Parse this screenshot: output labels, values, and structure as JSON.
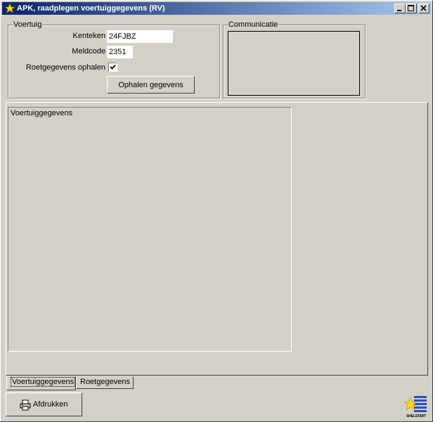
{
  "window": {
    "title": "APK, raadplegen voertuiggegevens (RV)",
    "controls": [
      "minimize",
      "maximize",
      "close"
    ]
  },
  "voertuig_group": {
    "legend": "Voertuig",
    "kenteken_label": "Kenteken",
    "kenteken_value": "24FJBZ",
    "meldcode_label": "Meldcode",
    "meldcode_value": "2351",
    "roet_label": "Roetgegevens ophalen",
    "roet_checked": true,
    "fetch_button": "Ophalen gegevens"
  },
  "communicatie_group": {
    "legend": "Communicatie"
  },
  "details_group": {
    "legend": "Voertuiggegevens"
  },
  "tabs": [
    {
      "label": "Voertuiggegevens",
      "active": true
    },
    {
      "label": "Roetgegevens",
      "active": false
    }
  ],
  "print_button": {
    "label": "Afdrukken",
    "icon": "printer-icon"
  },
  "logo": {
    "text": "SHELSTART",
    "icon": "shelstart-logo"
  },
  "colors": {
    "titlebar_start": "#0a246a",
    "titlebar_end": "#a6caf0",
    "face": "#d4d0c8"
  }
}
